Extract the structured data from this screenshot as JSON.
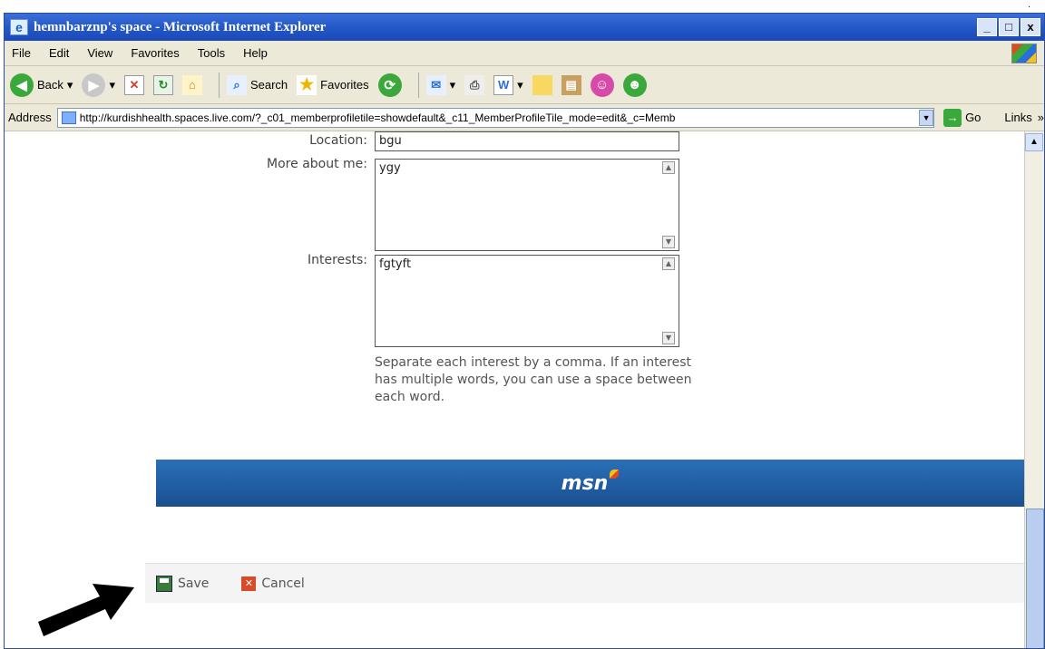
{
  "window": {
    "title": "hemnbarznp's space - Microsoft Internet Explorer",
    "minimize": "_",
    "maximize": "□",
    "close": "x"
  },
  "menu": [
    "File",
    "Edit",
    "View",
    "Favorites",
    "Tools",
    "Help"
  ],
  "toolbar": {
    "back": "Back",
    "search": "Search",
    "favorites": "Favorites"
  },
  "address": {
    "label": "Address",
    "url": "http://kurdishhealth.spaces.live.com/?_c01_memberprofiletile=showdefault&_c11_MemberProfileTile_mode=edit&_c=Memb",
    "go": "Go",
    "links": "Links"
  },
  "form": {
    "location_label": "Location:",
    "location_value": "bgu",
    "more_label": "More about me:",
    "more_value": "ygy",
    "interests_label": "Interests:",
    "interests_value": "fgtyft",
    "help_text": "Separate each interest by a comma. If an interest has multiple words, you can use a space between each word."
  },
  "banner": {
    "logo": "msn"
  },
  "actions": {
    "save": "Save",
    "cancel": "Cancel"
  }
}
